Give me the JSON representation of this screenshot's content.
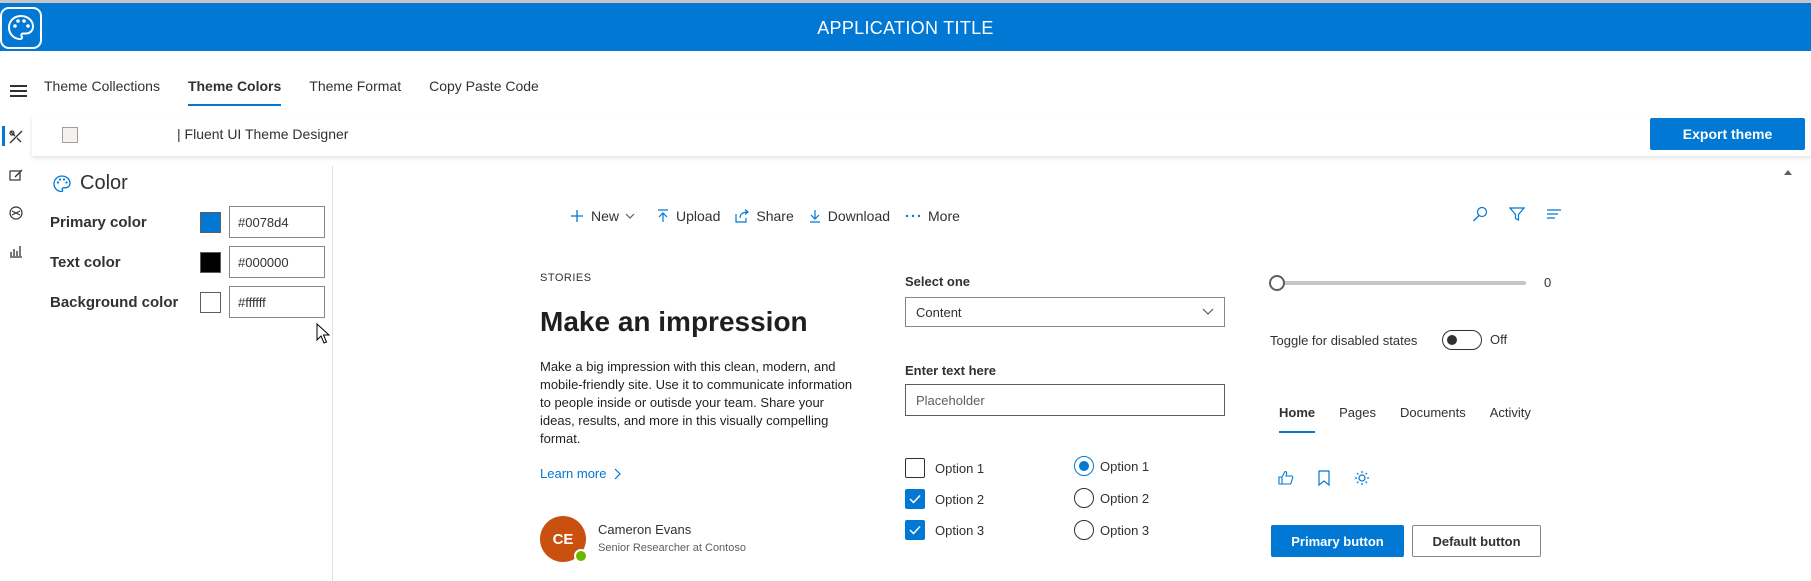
{
  "header": {
    "title": "APPLICATION TITLE"
  },
  "nav": {
    "tabs": [
      "Theme Collections",
      "Theme Colors",
      "Theme Format",
      "Copy Paste Code"
    ],
    "active_index": 1
  },
  "subheader": {
    "title": "| Fluent UI Theme Designer",
    "export_label": "Export theme"
  },
  "colors_panel": {
    "heading": "Color",
    "rows": [
      {
        "label": "Primary color",
        "value": "#0078d4",
        "swatch": "#0078d4"
      },
      {
        "label": "Text color",
        "value": "#000000",
        "swatch": "#000000"
      },
      {
        "label": "Background color",
        "value": "#ffffff",
        "swatch": "#ffffff"
      }
    ]
  },
  "command_bar": {
    "new": "New",
    "upload": "Upload",
    "share": "Share",
    "download": "Download",
    "more": "More"
  },
  "story": {
    "kicker": "STORIES",
    "headline": "Make an impression",
    "body": "Make a big impression with this clean, modern, and mobile-friendly site. Use it to communicate information to people inside or outisde your team. Share your ideas, results, and more in this visually compelling format.",
    "link": "Learn more",
    "person": {
      "initials": "CE",
      "name": "Cameron Evans",
      "role": "Senior Researcher at Contoso"
    }
  },
  "form": {
    "select_label": "Select one",
    "select_value": "Content",
    "text_label": "Enter text here",
    "text_placeholder": "Placeholder",
    "checkboxes": [
      {
        "label": "Option 1",
        "checked": false
      },
      {
        "label": "Option 2",
        "checked": true
      },
      {
        "label": "Option 3",
        "checked": true
      }
    ],
    "radios": [
      {
        "label": "Option 1",
        "checked": true
      },
      {
        "label": "Option 2",
        "checked": false
      },
      {
        "label": "Option 3",
        "checked": false
      }
    ]
  },
  "controls": {
    "slider_value": "0",
    "toggle_label": "Toggle for disabled states",
    "toggle_state": "Off",
    "pivots": [
      "Home",
      "Pages",
      "Documents",
      "Activity"
    ],
    "primary_button": "Primary button",
    "default_button": "Default button"
  },
  "theme": {
    "accent": "#0078d4",
    "avatar": "#ca5010",
    "presence": "#6bb700"
  }
}
